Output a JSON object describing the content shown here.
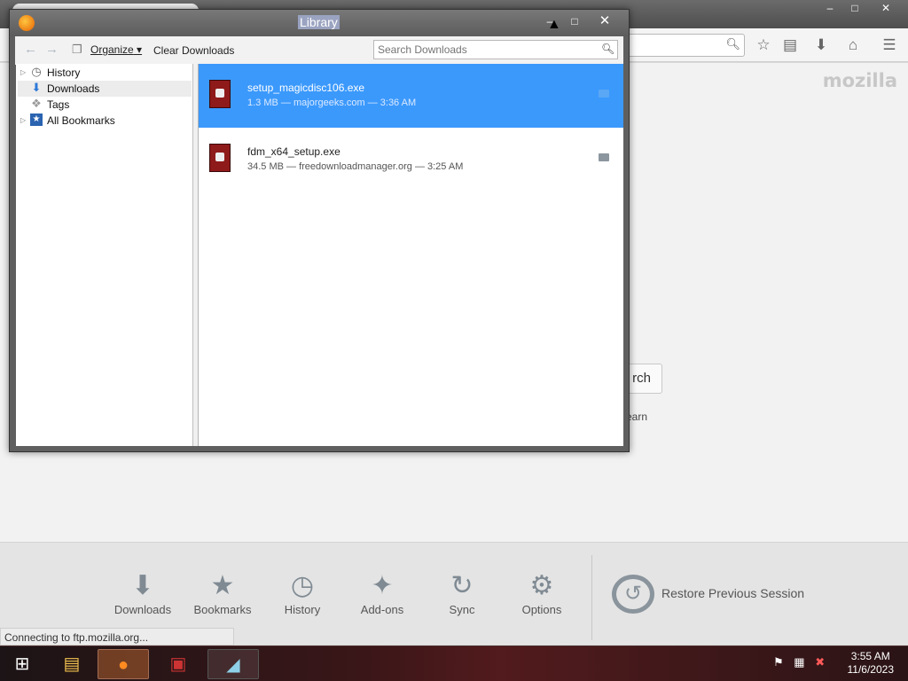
{
  "browser": {
    "mozilla_logo": "mozilla",
    "search_button_partial": "rch",
    "learn_partial": "earn",
    "launcher": [
      {
        "label": "Downloads",
        "icon": "download-arrow-icon"
      },
      {
        "label": "Bookmarks",
        "icon": "star-icon"
      },
      {
        "label": "History",
        "icon": "clock-icon"
      },
      {
        "label": "Add-ons",
        "icon": "puzzle-icon"
      },
      {
        "label": "Sync",
        "icon": "sync-icon"
      },
      {
        "label": "Options",
        "icon": "gear-icon"
      }
    ],
    "restore_label": "Restore Previous Session",
    "status": "Connecting to ftp.mozilla.org..."
  },
  "library": {
    "title": "Library",
    "toolbar": {
      "organize_label": "Organize",
      "clear_label": "Clear Downloads",
      "search_placeholder": "Search Downloads"
    },
    "sidebar": [
      {
        "label": "History",
        "icon": "clock-icon",
        "twisty": true
      },
      {
        "label": "Downloads",
        "icon": "download-arrow-icon",
        "twisty": false,
        "selected": true
      },
      {
        "label": "Tags",
        "icon": "tag-icon",
        "twisty": false
      },
      {
        "label": "All Bookmarks",
        "icon": "star-folder-icon",
        "twisty": true
      }
    ],
    "downloads": [
      {
        "name": "setup_magicdisc106.exe",
        "meta": "1.3 MB — majorgeeks.com — 3:36 AM",
        "selected": true
      },
      {
        "name": "fdm_x64_setup.exe",
        "meta": "34.5 MB — freedownloadmanager.org — 3:25 AM",
        "selected": false
      }
    ]
  },
  "taskbar": {
    "time": "3:55 AM",
    "date": "11/6/2023"
  },
  "colors": {
    "selection": "#3b99fc",
    "accent_firefox": "#e66000"
  }
}
